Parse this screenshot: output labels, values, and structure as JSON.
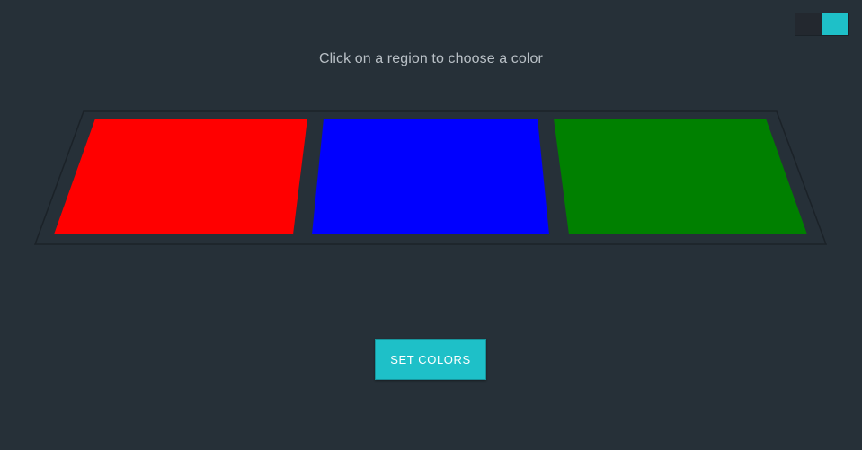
{
  "toggle": {
    "state": "on",
    "accent_color": "#1ec0c8"
  },
  "instruction": {
    "text": "Click on a region to choose a color"
  },
  "regions": [
    {
      "name": "region-left",
      "color": "#ff0000"
    },
    {
      "name": "region-center",
      "color": "#0000ff"
    },
    {
      "name": "region-right",
      "color": "#008000"
    }
  ],
  "actions": {
    "set_colors_label": "SET COLORS"
  },
  "theme": {
    "background": "#263038",
    "accent": "#1ec0c8"
  }
}
